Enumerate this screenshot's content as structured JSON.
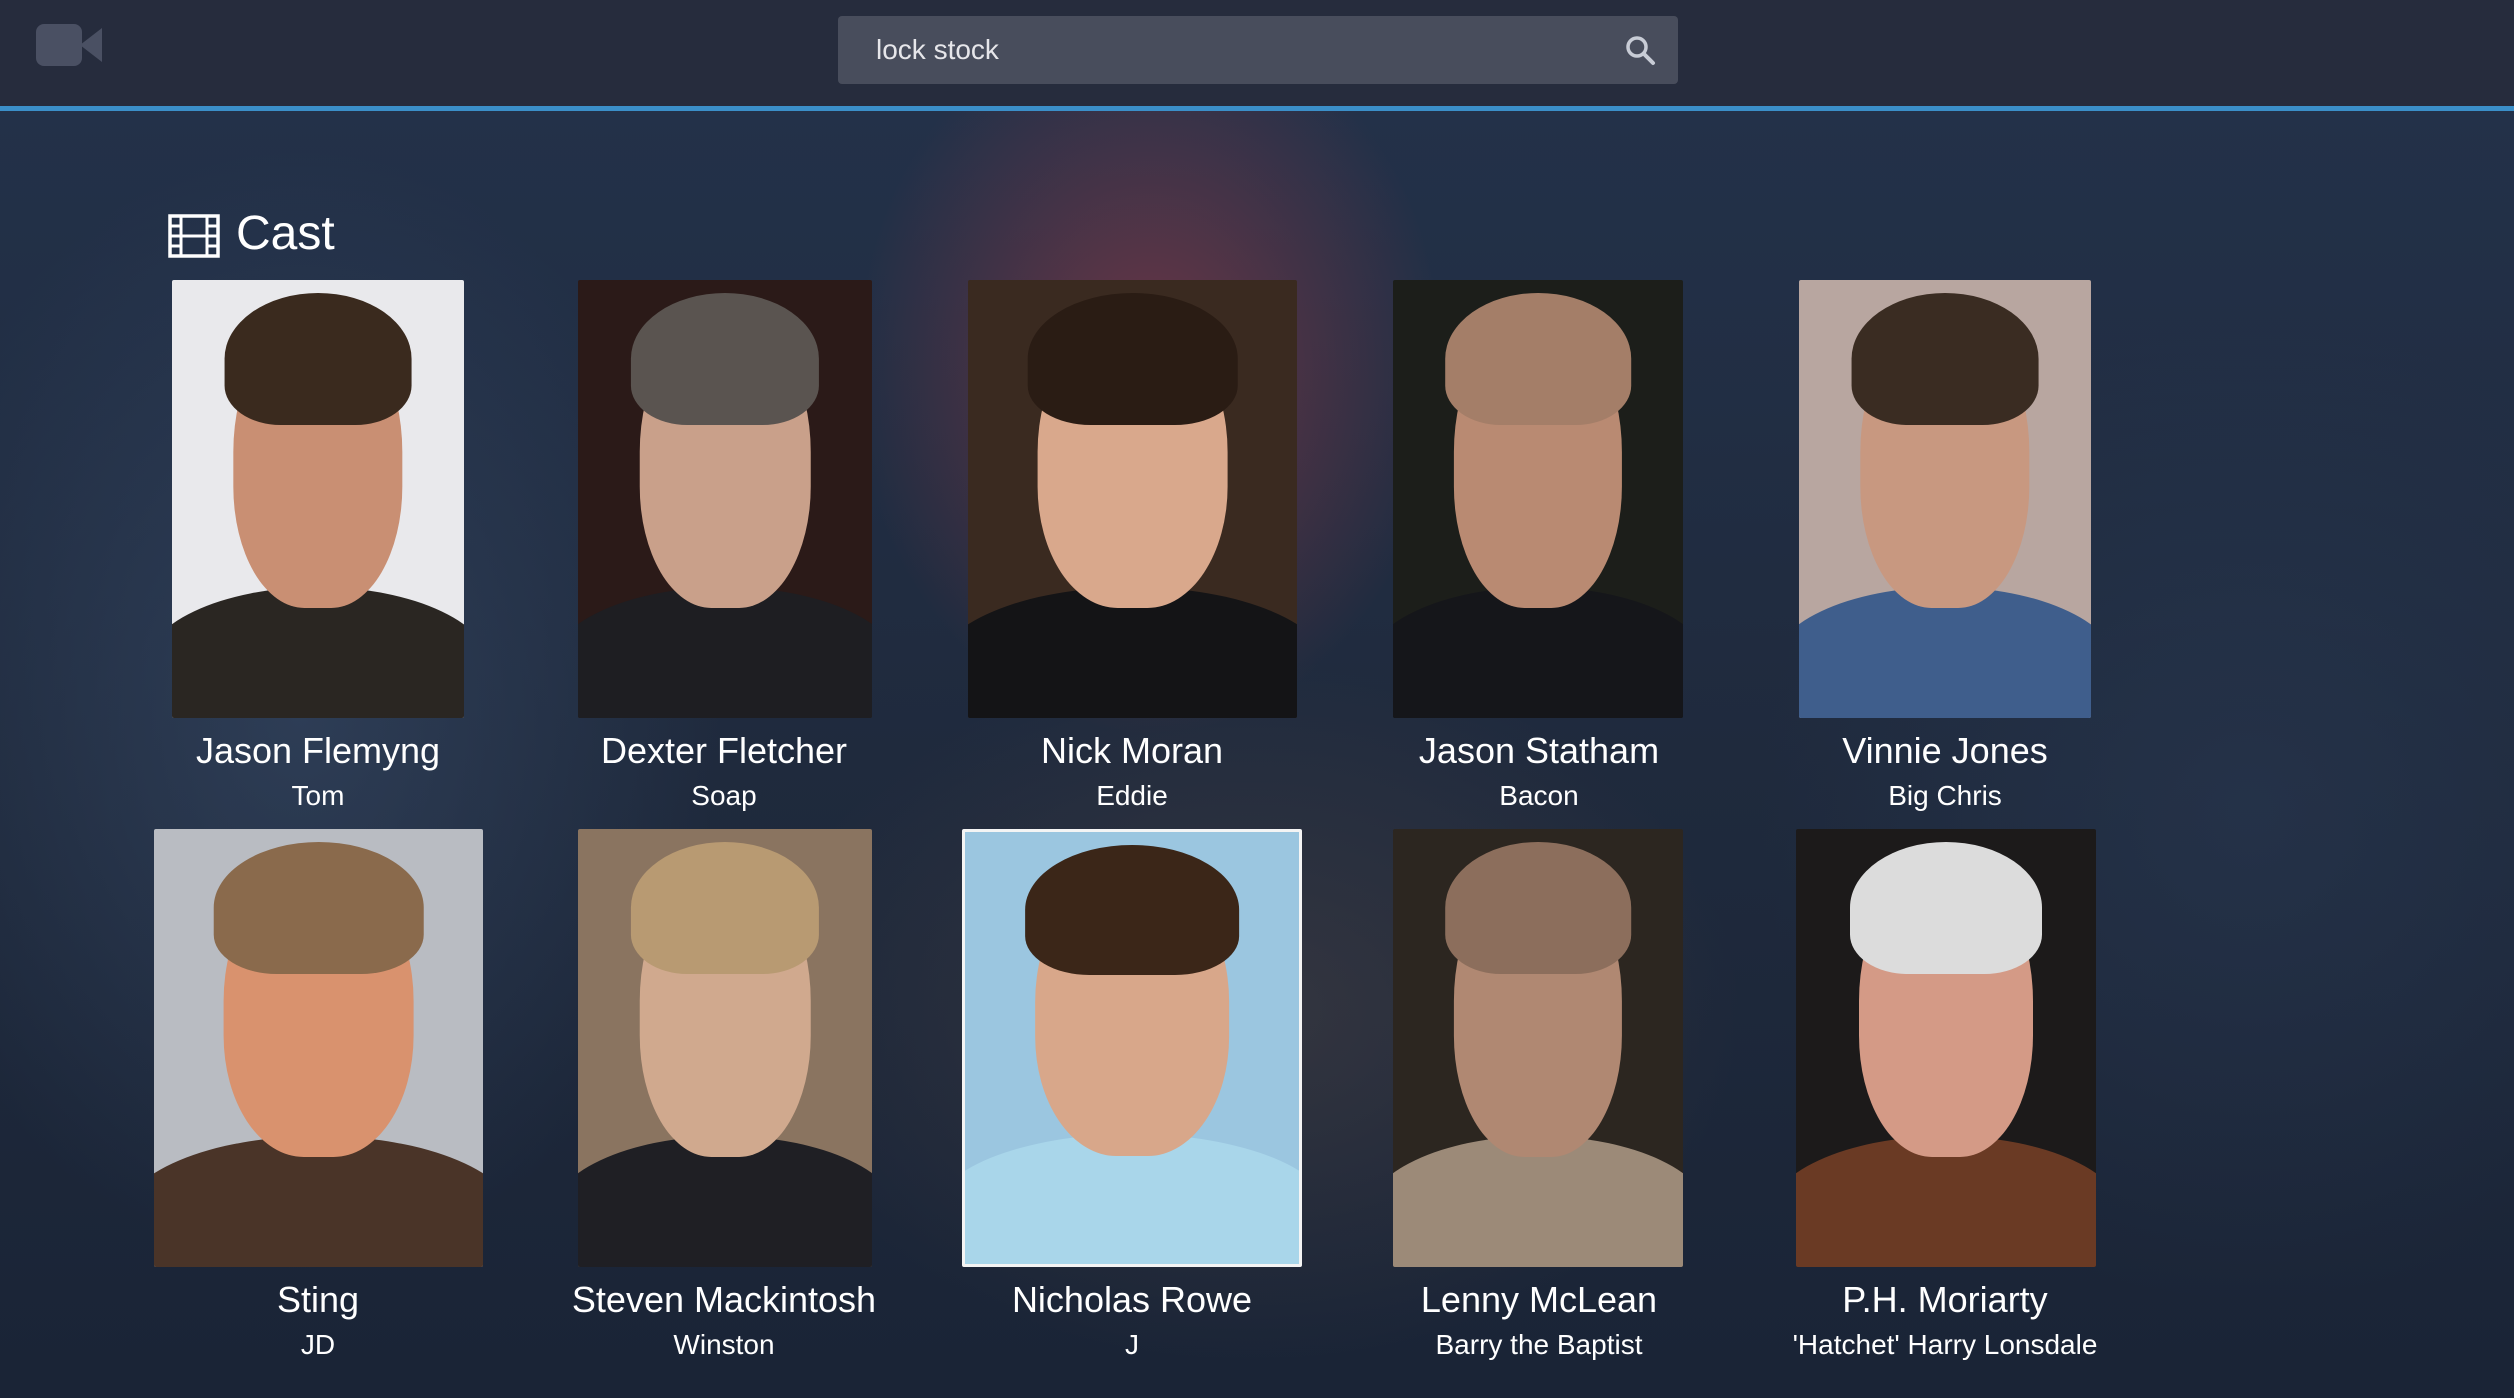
{
  "header": {
    "logo_icon": "video-camera-icon",
    "search": {
      "value": "lock stock",
      "icon": "search-icon"
    }
  },
  "section": {
    "title": "Cast",
    "icon": "film-icon"
  },
  "colors": {
    "accent": "#3b8fc9",
    "topbar": "#262c3d",
    "search_bg": "#484d5c"
  },
  "cast": [
    {
      "name": "Jason Flemyng",
      "role": "Tom"
    },
    {
      "name": "Dexter Fletcher",
      "role": "Soap"
    },
    {
      "name": "Nick Moran",
      "role": "Eddie"
    },
    {
      "name": "Jason Statham",
      "role": "Bacon"
    },
    {
      "name": "Vinnie Jones",
      "role": "Big Chris"
    },
    {
      "name": "Sting",
      "role": "JD"
    },
    {
      "name": "Steven Mackintosh",
      "role": "Winston"
    },
    {
      "name": "Nicholas Rowe",
      "role": "J"
    },
    {
      "name": "Lenny McLean",
      "role": "Barry the Baptist"
    },
    {
      "name": "P.H. Moriarty",
      "role": "'Hatchet' Harry Lonsdale"
    }
  ]
}
